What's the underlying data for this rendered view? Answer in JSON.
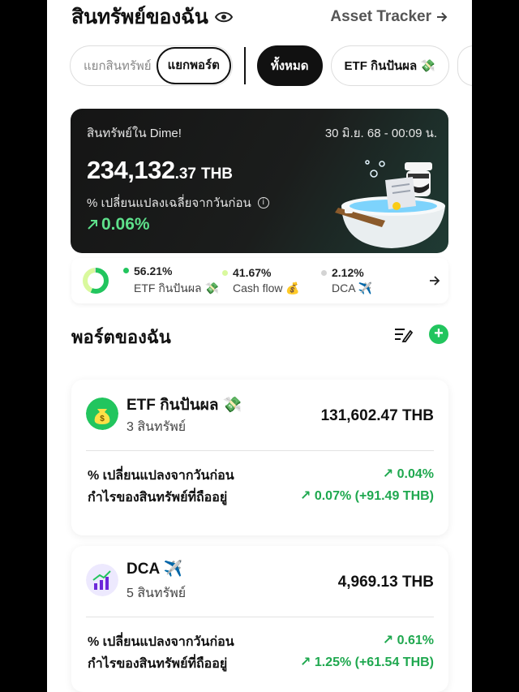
{
  "header": {
    "title": "สินทรัพย์ของฉัน",
    "tracker_link": "Asset Tracker",
    "eye_icon": "eye-icon",
    "arrow_icon": "arrow-right-icon"
  },
  "filters": {
    "segment_options": [
      "แยกสินทรัพย์",
      "แยกพอร์ต"
    ],
    "segment_selected": "แยกพอร์ต",
    "chips": [
      "ทั้งหมด",
      "ETF กินปันผล 💸"
    ],
    "chip_selected": "ทั้งหมด"
  },
  "balance_card": {
    "label": "สินทรัพย์ใน Dime!",
    "date": "30 มิ.ย. 68 - 00:09 น.",
    "amount_int": "234,132",
    "amount_dec": ".37",
    "currency": "THB",
    "change_label": "% เปลี่ยนแปลงเฉลี่ยจากวันก่อน",
    "change_value": "0.06%",
    "colors": {
      "positive": "#5ee08b",
      "card_bg": "#151515"
    }
  },
  "allocation": {
    "items": [
      {
        "pct": "56.21%",
        "name": "ETF กินปันผล 💸",
        "color": "#22c55e",
        "fraction": 0.5621
      },
      {
        "pct": "41.67%",
        "name": "Cash flow 💰",
        "color": "#d9f99d",
        "fraction": 0.4167
      },
      {
        "pct": "2.12%",
        "name": "DCA ✈️",
        "color": "#d4d4d4",
        "fraction": 0.0212
      }
    ]
  },
  "portfolio_section": {
    "title": "พอร์ตของฉัน",
    "edit_icon": "edit-list-icon",
    "add_icon": "plus-icon",
    "add_label": "+"
  },
  "portfolios": [
    {
      "name": "ETF กินปันผล 💸",
      "count": "3 สินทรัพย์",
      "value": "131,602.47 THB",
      "change_label": "% เปลี่ยนแปลงจากวันก่อน",
      "change_value": "↗ 0.04%",
      "profit_label": "กำไรของสินทรัพย์ที่ถืออยู่",
      "profit_value": "↗ 0.07% (+91.49 THB)",
      "icon": "money-bag-icon"
    },
    {
      "name": "DCA ✈️",
      "count": "5 สินทรัพย์",
      "value": "4,969.13 THB",
      "change_label": "% เปลี่ยนแปลงจากวันก่อน",
      "change_value": "↗ 0.61%",
      "profit_label": "กำไรของสินทรัพย์ที่ถืออยู่",
      "profit_value": "↗ 1.25% (+61.54 THB)",
      "icon": "growth-chart-icon"
    }
  ]
}
